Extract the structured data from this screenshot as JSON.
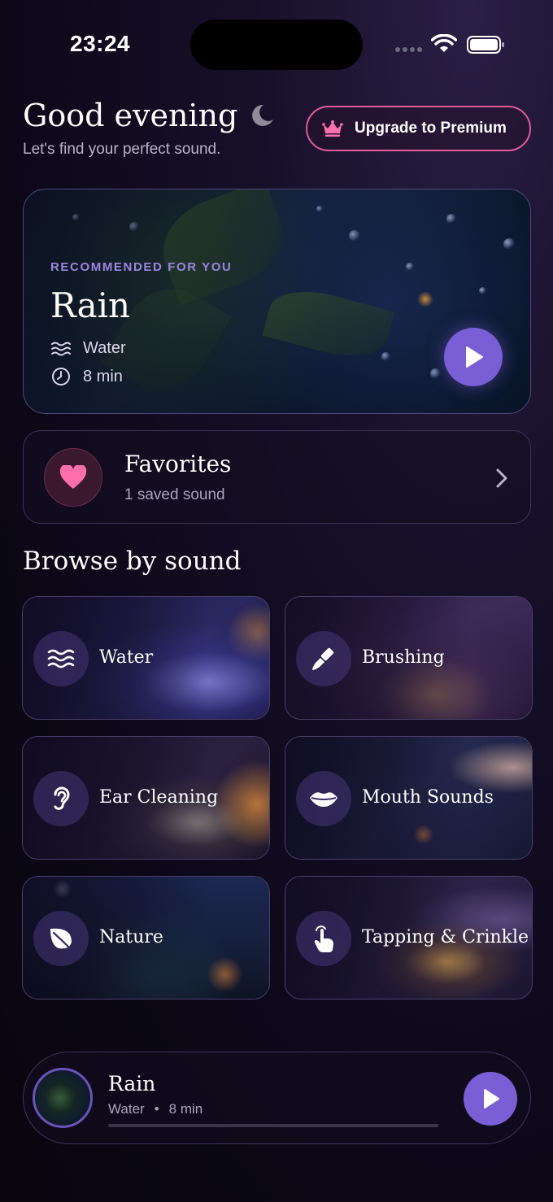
{
  "status_bar": {
    "time": "23:24"
  },
  "header": {
    "greeting": "Good evening",
    "subtitle": "Let's find your perfect sound.",
    "premium_label": "Upgrade to Premium"
  },
  "recommended": {
    "label": "RECOMMENDED FOR YOU",
    "title": "Rain",
    "category": "Water",
    "duration": "8 min"
  },
  "favorites": {
    "title": "Favorites",
    "subtitle": "1 saved sound"
  },
  "browse": {
    "title": "Browse by sound",
    "categories": [
      {
        "label": "Water",
        "icon": "waves-icon"
      },
      {
        "label": "Brushing",
        "icon": "brush-icon"
      },
      {
        "label": "Ear Cleaning",
        "icon": "ear-icon"
      },
      {
        "label": "Mouth Sounds",
        "icon": "lips-icon"
      },
      {
        "label": "Nature",
        "icon": "leaf-icon"
      },
      {
        "label": "Tapping & Crinkle",
        "icon": "tap-hand-icon"
      }
    ]
  },
  "player": {
    "title": "Rain",
    "category": "Water",
    "separator": "•",
    "duration": "8 min",
    "progress": 0
  },
  "colors": {
    "accent": "#7a5ed6",
    "premium_border": "#e45c9a",
    "heart": "#ff6fae",
    "label_purple": "#9b86e0"
  }
}
